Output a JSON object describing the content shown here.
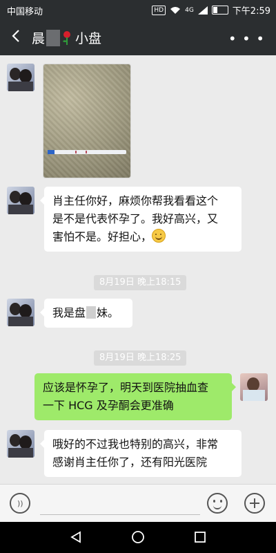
{
  "status_bar": {
    "carrier": "中国移动",
    "network": "4G",
    "time": "下午2:59"
  },
  "header": {
    "title_left": "晨",
    "title_right": "小盘"
  },
  "messages": [
    {
      "type": "image",
      "side": "left"
    },
    {
      "type": "text",
      "side": "left",
      "lines": [
        "肖主任你好，麻烦你帮我看看这个",
        "是不是代表怀孕了。我好高兴，又",
        "害怕不是。好担心，"
      ]
    },
    {
      "type": "time",
      "text": "8月19日 晚上18:15"
    },
    {
      "type": "text",
      "side": "left",
      "parts": [
        "我是盘",
        "妹。"
      ]
    },
    {
      "type": "time",
      "text": "8月19日 晚上18:25"
    },
    {
      "type": "text",
      "side": "right",
      "lines": [
        "应该是怀孕了，明天到医院抽血查",
        "一下 HCG 及孕酮会更准确"
      ]
    },
    {
      "type": "text",
      "side": "left",
      "lines": [
        "哦好的不过我也特别的高兴，非常",
        "感谢肖主任你了，还有阳光医院"
      ]
    }
  ],
  "colors": {
    "bar": "#2b2e30",
    "chat_bg": "#ebebeb",
    "bubble_right": "#9eea6a",
    "bubble_left": "#ffffff"
  },
  "icons": [
    "back-arrow-icon",
    "more-icon",
    "voice-icon",
    "emoji-icon",
    "plus-icon",
    "nav-back-icon",
    "nav-home-icon",
    "nav-recent-icon"
  ]
}
